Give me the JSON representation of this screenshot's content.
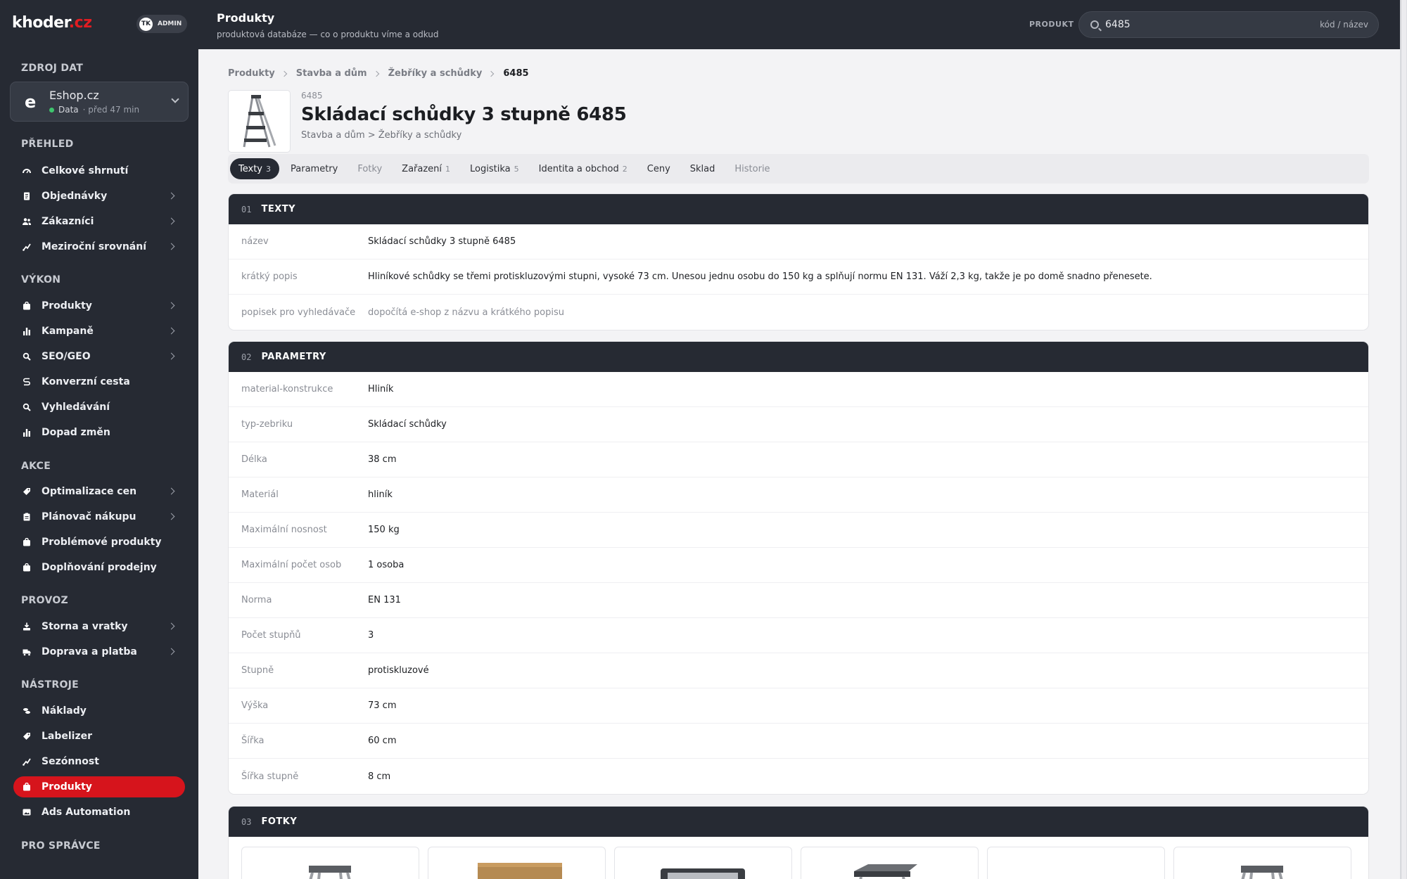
{
  "brand": {
    "logo_a": "khoder",
    "logo_b": ".cz",
    "user_initials": "TK",
    "user_role": "ADMIN"
  },
  "sidebar": {
    "source_heading": "ZDROJ DAT",
    "source": {
      "letter": "e",
      "name": "Eshop.cz",
      "status": "Data",
      "status_age": "· před 47 min"
    },
    "sections": {
      "overview": "PŘEHLED",
      "performance": "VÝKON",
      "actions": "AKCE",
      "operations": "PROVOZ",
      "tools": "NÁSTROJE",
      "admin": "PRO SPRÁVCE"
    },
    "items": [
      {
        "label": "Celkové shrnutí"
      },
      {
        "label": "Objednávky"
      },
      {
        "label": "Zákazníci"
      },
      {
        "label": "Meziroční srovnání"
      },
      {
        "label": "Produkty"
      },
      {
        "label": "Kampaně"
      },
      {
        "label": "SEO/GEO"
      },
      {
        "label": "Konverzní cesta"
      },
      {
        "label": "Vyhledávání"
      },
      {
        "label": "Dopad změn"
      },
      {
        "label": "Optimalizace cen"
      },
      {
        "label": "Plánovač nákupu"
      },
      {
        "label": "Problémové produkty"
      },
      {
        "label": "Doplňování prodejny"
      },
      {
        "label": "Storna a vratky"
      },
      {
        "label": "Doprava a platba"
      },
      {
        "label": "Náklady"
      },
      {
        "label": "Labelizer"
      },
      {
        "label": "Sezónnost"
      },
      {
        "label": "Produkty"
      },
      {
        "label": "Ads Automation"
      }
    ]
  },
  "topbar": {
    "title": "Produkty",
    "subtitle": "produktová databáze — co o produktu víme a odkud",
    "product_label": "PRODUKT",
    "search_value": "6485",
    "search_hint": "kód / název"
  },
  "breadcrumb": [
    "Produkty",
    "Stavba a dům",
    "Žebříky a schůdky",
    "6485"
  ],
  "product": {
    "code": "6485",
    "title": "Skládací schůdky 3 stupně 6485",
    "category": "Stavba a dům > Žebříky a schůdky"
  },
  "tabs": [
    {
      "label": "Texty",
      "count": "3"
    },
    {
      "label": "Parametry",
      "count": ""
    },
    {
      "label": "Fotky",
      "count": ""
    },
    {
      "label": "Zařazení",
      "count": "1"
    },
    {
      "label": "Logistika",
      "count": "5"
    },
    {
      "label": "Identita a obchod",
      "count": "2"
    },
    {
      "label": "Ceny",
      "count": ""
    },
    {
      "label": "Sklad",
      "count": ""
    },
    {
      "label": "Historie",
      "count": ""
    }
  ],
  "texts": {
    "num": "01",
    "title": "TEXTY",
    "rows": [
      {
        "key": "název",
        "value": "Skládací schůdky 3 stupně 6485"
      },
      {
        "key": "krátký popis",
        "value": "Hliníkové schůdky se třemi protiskluzovými stupni, vysoké 73 cm. Unesou jednu osobu do 150 kg a splňují normu EN 131. Váží 2,3 kg, takže je po domě snadno přenesete."
      },
      {
        "key": "popisek pro vyhledávače",
        "value": "dopočítá e-shop z názvu a krátkého popisu"
      }
    ]
  },
  "params": {
    "num": "02",
    "title": "PARAMETRY",
    "rows": [
      {
        "key": "material-konstrukce",
        "value": "Hliník"
      },
      {
        "key": "typ-zebriku",
        "value": "Skládací schůdky"
      },
      {
        "key": "Délka",
        "value": "38 cm"
      },
      {
        "key": "Materiál",
        "value": "hliník"
      },
      {
        "key": "Maximální nosnost",
        "value": "150 kg"
      },
      {
        "key": "Maximální počet osob",
        "value": "1 osoba"
      },
      {
        "key": "Norma",
        "value": "EN 131"
      },
      {
        "key": "Počet stupňů",
        "value": "3"
      },
      {
        "key": "Stupně",
        "value": "protiskluzové"
      },
      {
        "key": "Výška",
        "value": "73 cm"
      },
      {
        "key": "Šířka",
        "value": "60 cm"
      },
      {
        "key": "Šířka stupně",
        "value": "8 cm"
      }
    ]
  },
  "photos": {
    "num": "03",
    "title": "FOTKY"
  },
  "colors": {
    "sidebar_bg": "#262a33",
    "accent": "#d6141c",
    "status_ok": "#3ec46d"
  },
  "icons": [
    "gauge-icon",
    "document-icon",
    "users-icon",
    "trend-icon",
    "bag-icon",
    "bar-chart-icon",
    "search-sparkle-icon",
    "route-icon",
    "search-icon",
    "bar-chart-icon",
    "tag-icon",
    "clipboard-icon",
    "bag-icon",
    "bag-icon",
    "return-icon",
    "truck-icon",
    "coins-icon",
    "tag-icon",
    "trend-icon",
    "bag-icon",
    "image-icon"
  ]
}
